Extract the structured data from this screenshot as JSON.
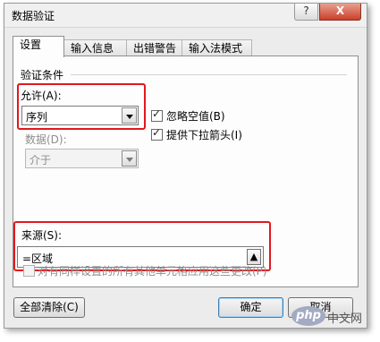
{
  "window": {
    "title": "数据验证",
    "help": "?",
    "close": "X"
  },
  "tabs": [
    "设置",
    "输入信息",
    "出错警告",
    "输入法模式"
  ],
  "criteria": {
    "group_title": "验证条件",
    "allow_label": "允许(A):",
    "allow_value": "序列",
    "data_label": "数据(D):",
    "data_value": "介于",
    "ignore_blank": {
      "label": "忽略空值(B)",
      "checked": true
    },
    "in_cell_dropdown": {
      "label": "提供下拉箭头(I)",
      "checked": true
    },
    "source_label": "来源(S):",
    "source_value": "=区域"
  },
  "apply_all": {
    "label": "对有同样设置的所有其他单元格应用这些更改(P)",
    "checked": false
  },
  "buttons": {
    "clear_all": "全部清除(C)",
    "ok": "确定",
    "cancel": "取消"
  },
  "watermark": {
    "logo": "php",
    "text": "中文网"
  }
}
